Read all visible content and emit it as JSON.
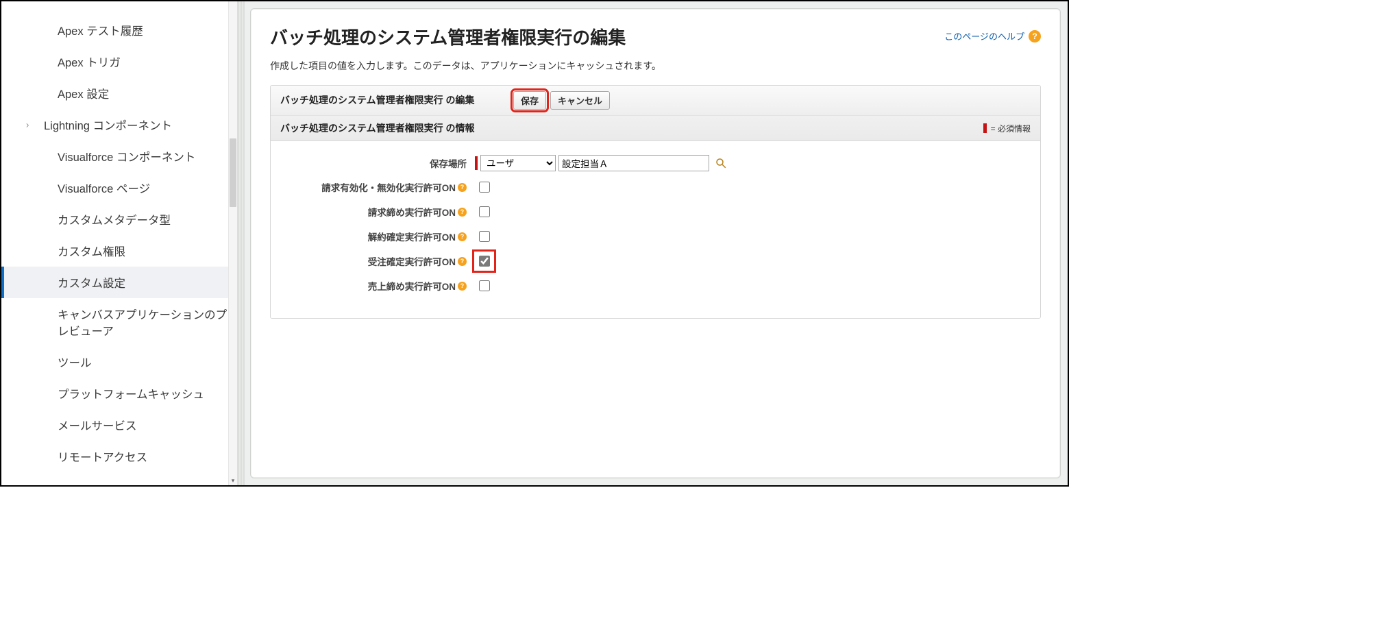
{
  "sidebar": {
    "items": [
      {
        "label": "Apex テスト履歴",
        "indent": true
      },
      {
        "label": "Apex トリガ",
        "indent": true
      },
      {
        "label": "Apex 設定",
        "indent": true
      },
      {
        "label": "Lightning コンポーネント",
        "indent": false,
        "expandable": true
      },
      {
        "label": "Visualforce コンポーネント",
        "indent": true
      },
      {
        "label": "Visualforce ページ",
        "indent": true
      },
      {
        "label": "カスタムメタデータ型",
        "indent": true
      },
      {
        "label": "カスタム権限",
        "indent": true
      },
      {
        "label": "カスタム設定",
        "indent": true,
        "selected": true
      },
      {
        "label": "キャンバスアプリケーションのプレビューア",
        "indent": true
      },
      {
        "label": "ツール",
        "indent": true
      },
      {
        "label": "プラットフォームキャッシュ",
        "indent": true
      },
      {
        "label": "メールサービス",
        "indent": true
      },
      {
        "label": "リモートアクセス",
        "indent": true
      }
    ]
  },
  "page": {
    "title": "バッチ処理のシステム管理者権限実行の編集",
    "help_label": "このページのヘルプ",
    "description": "作成した項目の値を入力します。このデータは、アプリケーションにキャッシュされます。"
  },
  "header_block": {
    "label": "バッチ処理のシステム管理者権限実行 の編集",
    "save": "保存",
    "cancel": "キャンセル"
  },
  "section": {
    "title": "バッチ処理のシステム管理者権限実行 の情報",
    "required_legend": "= 必須情報"
  },
  "fields": {
    "location": {
      "label": "保存場所",
      "select_value": "ユーザ",
      "text_value": "設定担当Ａ"
    },
    "cb1": {
      "label": "請求有効化・無効化実行許可ON",
      "checked": false
    },
    "cb2": {
      "label": "請求締め実行許可ON",
      "checked": false
    },
    "cb3": {
      "label": "解約確定実行許可ON",
      "checked": false
    },
    "cb4": {
      "label": "受注確定実行許可ON",
      "checked": true,
      "highlight": true
    },
    "cb5": {
      "label": "売上締め実行許可ON",
      "checked": false
    }
  }
}
